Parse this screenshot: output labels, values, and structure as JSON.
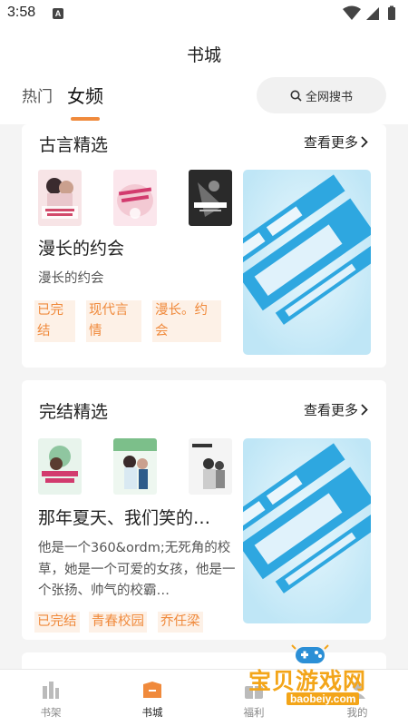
{
  "status": {
    "time": "3:58",
    "notif_letter": "A"
  },
  "header": {
    "title": "书城",
    "tabs": [
      {
        "label": "热门"
      },
      {
        "label": "女频"
      }
    ],
    "active_tab": "女频",
    "search_label": "全网搜书"
  },
  "sections": [
    {
      "title": "古言精选",
      "more": "查看更多",
      "book": {
        "name": "漫长的约会",
        "desc": "漫长的约会",
        "tags": [
          "已完结",
          "现代言情",
          "漫长。约会"
        ]
      }
    },
    {
      "title": "完结精选",
      "more": "查看更多",
      "book": {
        "name": "那年夏天、我们笑的…",
        "desc": "他是一个360&ordm;无死角的校草，她是一个可爱的女孩，他是一个张扬、帅气的校霸…",
        "tags": [
          "已完结",
          "青春校园",
          "乔任梁"
        ]
      }
    }
  ],
  "nav": [
    {
      "label": "书架",
      "icon": "bookshelf-icon"
    },
    {
      "label": "书城",
      "icon": "bookstore-icon"
    },
    {
      "label": "福利",
      "icon": "gift-icon"
    },
    {
      "label": "我的",
      "icon": "user-icon"
    }
  ],
  "colors": {
    "accent": "#f08a3c",
    "tag_bg": "#fdf1e7",
    "banner": "#2ea7e0"
  },
  "watermark": {
    "text": "宝贝游戏网",
    "url": "baobeiy.com"
  }
}
